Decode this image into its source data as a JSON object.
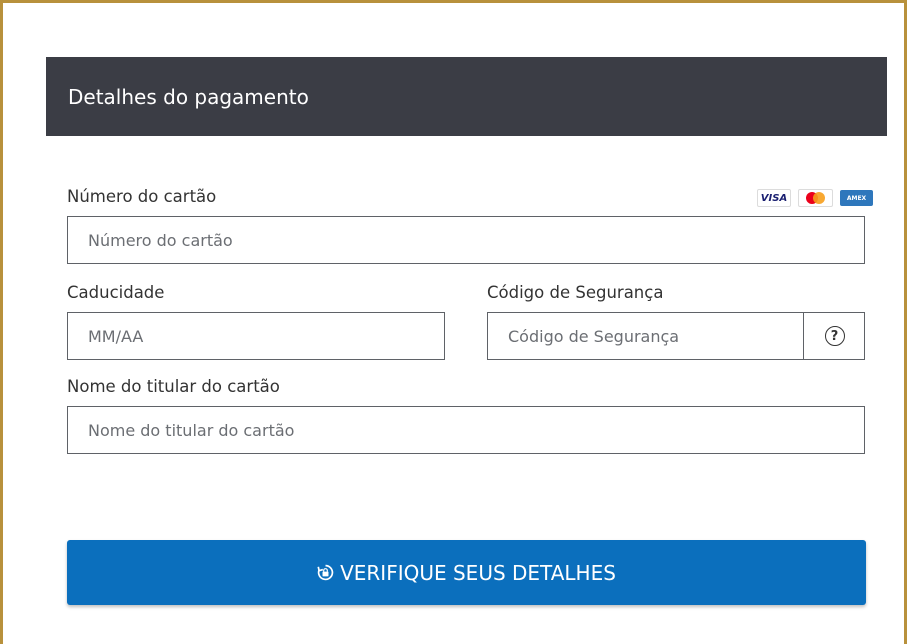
{
  "header": {
    "title": "Detalhes do pagamento"
  },
  "card_number": {
    "label": "Número do cartão",
    "placeholder": "Número do cartão",
    "value": "",
    "accepted_cards": [
      {
        "name": "visa",
        "label": "VISA"
      },
      {
        "name": "mastercard",
        "label": ""
      },
      {
        "name": "amex",
        "label": "AMEX"
      }
    ]
  },
  "expiry": {
    "label": "Caducidade",
    "placeholder": "MM/AA",
    "value": ""
  },
  "security_code": {
    "label": "Código de Segurança",
    "placeholder": "Código de Segurança",
    "value": "",
    "help_icon": "?"
  },
  "cardholder_name": {
    "label": "Nome do titular do cartão",
    "placeholder": "Nome do titular do cartão",
    "value": ""
  },
  "submit": {
    "label": "VERIFIQUE SEUS DETALHES",
    "icon": "lock-refresh-icon"
  },
  "colors": {
    "frame_border": "#b8913c",
    "header_bg": "#3b3d45",
    "button_bg": "#0b6fbd",
    "input_border": "#5f6267"
  }
}
